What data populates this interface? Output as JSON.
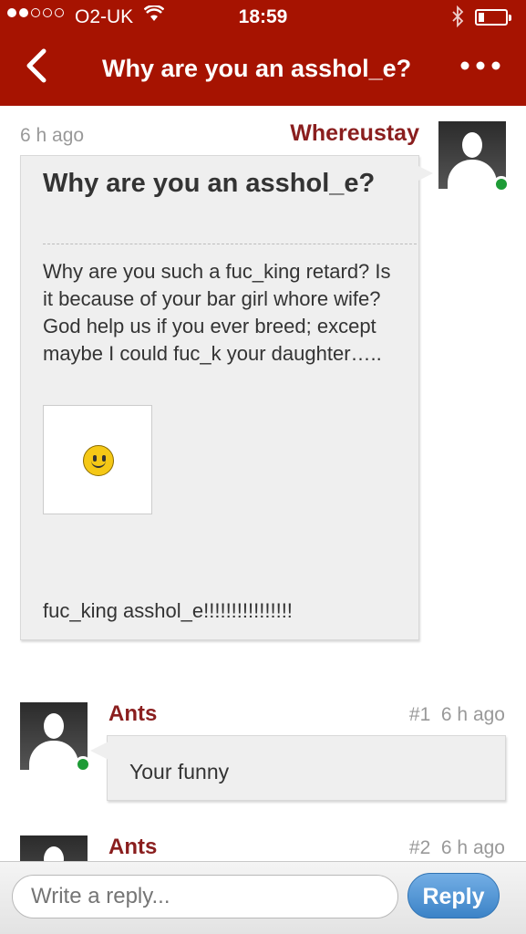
{
  "status_bar": {
    "carrier": "O2-UK",
    "time": "18:59"
  },
  "navbar": {
    "back_icon": "chevron-left-icon",
    "title": "Why are you an asshol_e?",
    "more_icon": "more-dots-icon"
  },
  "post": {
    "time": "6 h ago",
    "author": "Whereustay",
    "title": "Why are you an asshol_e?",
    "body": "Why are you such a fuc_king retard? Is it because of your bar girl whore wife? God help us if you ever breed; except maybe I could fuc_k your daughter…..",
    "image_icon": "smiley-icon",
    "footer": "fuc_king asshol_e!!!!!!!!!!!!!!!!"
  },
  "replies": [
    {
      "author": "Ants",
      "number": "#1",
      "time": "6 h ago",
      "text": "Your funny"
    },
    {
      "author": "Ants",
      "number": "#2",
      "time": "6 h ago",
      "text": ""
    }
  ],
  "composer": {
    "placeholder": "Write a reply...",
    "reply_label": "Reply"
  },
  "colors": {
    "header_bg": "#a61301",
    "author": "#8a1e1e",
    "online": "#1e9b36",
    "reply_button": "#4a90d2"
  }
}
